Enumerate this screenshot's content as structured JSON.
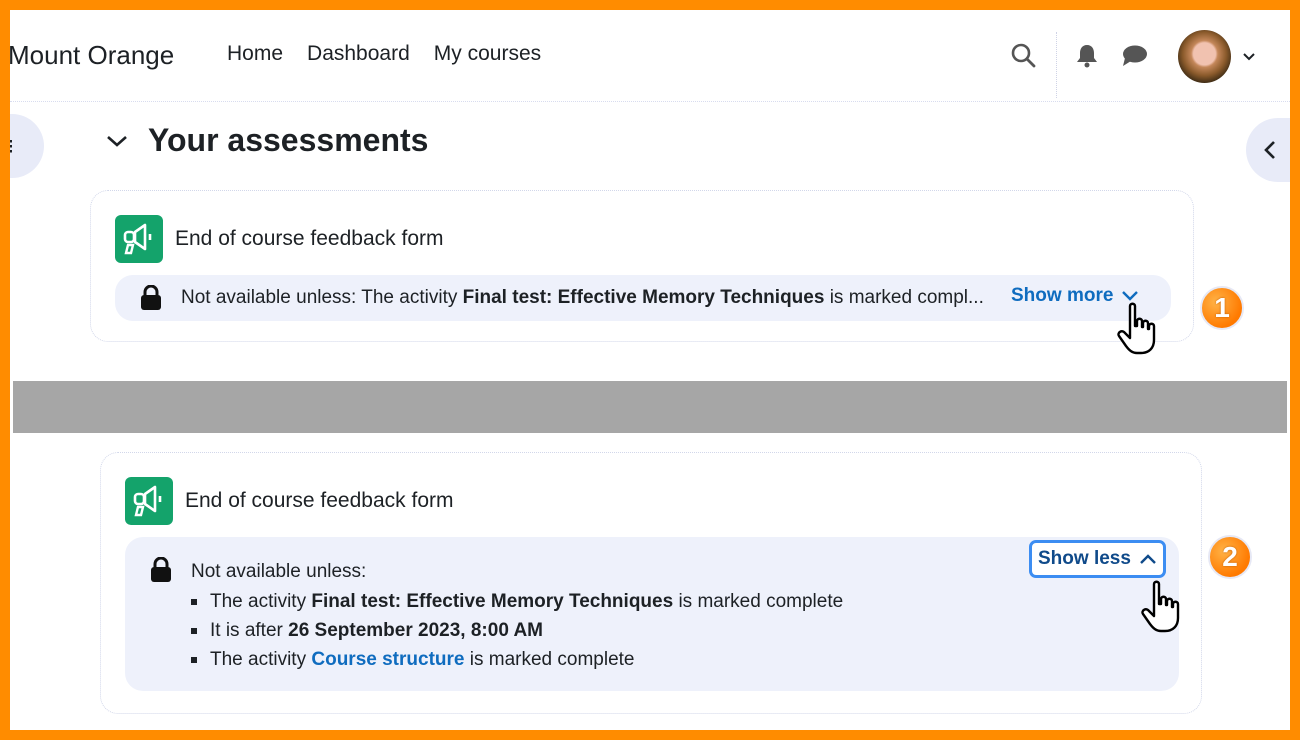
{
  "navbar": {
    "brand": "Mount Orange",
    "links": [
      "Home",
      "Dashboard",
      "My courses"
    ],
    "icons": [
      "search-icon",
      "bell-icon",
      "chat-icon",
      "avatar",
      "chevron-down-icon"
    ]
  },
  "section": {
    "title": "Your assessments",
    "collapse_icon": "chevron-down-icon"
  },
  "cards": [
    {
      "activity_name": "End of course feedback form",
      "icon": "megaphone-icon",
      "restriction": {
        "prefix": "Not available unless: The activity ",
        "bold": "Final test: Effective Memory Techniques",
        "suffix": " is marked compl...",
        "toggle_label": "Show more",
        "toggle_icon": "chevron-down-icon"
      },
      "step_badge": "1"
    },
    {
      "activity_name": "End of course feedback form",
      "icon": "megaphone-icon",
      "restriction": {
        "lead": "Not available unless:",
        "toggle_label": "Show less",
        "toggle_icon": "chevron-up-icon",
        "conditions": [
          {
            "pre": "The activity ",
            "bold": "Final test: Effective Memory Techniques",
            "post": " is marked complete"
          },
          {
            "pre": "It is after ",
            "bold": "26 September 2023, 8:00 AM",
            "post": ""
          },
          {
            "pre": "The activity ",
            "link": "Course structure",
            "post": " is marked complete"
          }
        ]
      },
      "step_badge": "2"
    }
  ],
  "colors": {
    "frame": "#ff8c00",
    "activity_icon": "#14a36b",
    "link": "#0f6cbf",
    "focus_ring": "#3c8df2"
  }
}
